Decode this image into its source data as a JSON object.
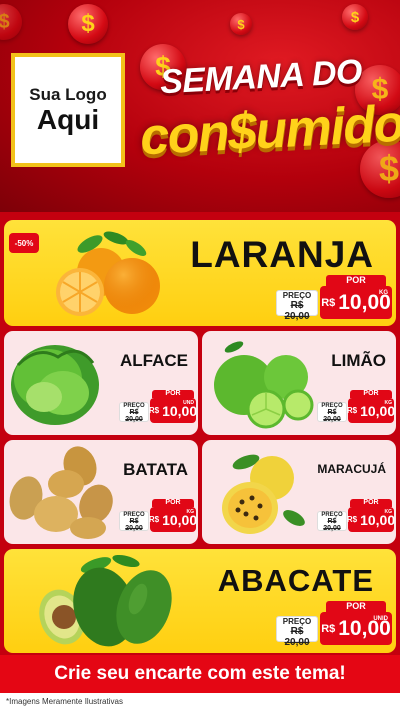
{
  "header": {
    "logo_line1": "Sua Logo",
    "logo_line2": "Aqui",
    "title_line1": "SEMANA DO",
    "title_line2": "con$umidor",
    "coin_symbol": "$"
  },
  "badge": "-50%",
  "price_labels": {
    "old_label": "PREÇO",
    "por": "POR",
    "currency": "R$",
    "old_prefix": "R$"
  },
  "products": [
    {
      "name": "LARANJA",
      "old_price": "20,00",
      "price": "10,00",
      "unit": "KG"
    },
    {
      "name": "ALFACE",
      "old_price": "20,00",
      "price": "10,00",
      "unit": "UND"
    },
    {
      "name": "LIMÃO",
      "old_price": "20,00",
      "price": "10,00",
      "unit": "KG"
    },
    {
      "name": "BATATA",
      "old_price": "20,00",
      "price": "10,00",
      "unit": "KG"
    },
    {
      "name": "MARACUJÁ",
      "old_price": "20,00",
      "price": "10,00",
      "unit": "KG"
    },
    {
      "name": "ABACATE",
      "old_price": "20,00",
      "price": "10,00",
      "unit": "UNID"
    }
  ],
  "footer": {
    "cta": "Crie seu encarte com este tema!",
    "disclaimer": "*Imagens Meramente Ilustrativas"
  },
  "colors": {
    "background_red": "#b5000f",
    "tag_red": "#e10716",
    "card_yellow": "#ffd61f",
    "card_pink": "#fbe6e8",
    "title_yellow": "#ffd21a"
  }
}
